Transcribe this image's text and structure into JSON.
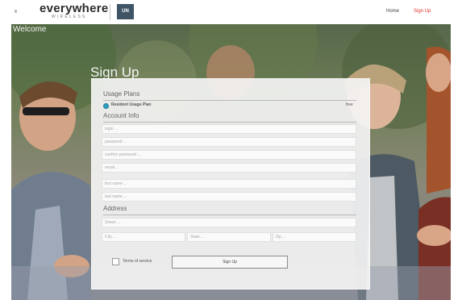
{
  "brand": {
    "name": "everywhere",
    "tagline": "WIRELESS",
    "badge": "UN"
  },
  "nav": {
    "home": "Home",
    "signup": "Sign Up"
  },
  "hero": {
    "welcome": "Welcome",
    "heading": "Sign Up"
  },
  "usage_plans": {
    "title": "Usage Plans",
    "plan_label": "Resident Usage Plan",
    "plan_price": "free",
    "plan_selected": true
  },
  "account": {
    "title": "Account Info",
    "login_placeholder": "login ...",
    "password_placeholder": "password ...",
    "confirm_placeholder": "confirm password ...",
    "email_placeholder": "email ...",
    "first_name_placeholder": "first name ...",
    "last_name_placeholder": "last name ..."
  },
  "address": {
    "title": "Address",
    "street_placeholder": "Street ...",
    "city_placeholder": "City ...",
    "state_placeholder": "State ...",
    "zip_placeholder": "Zip ..."
  },
  "terms": {
    "label": "Terms of service",
    "checked": false
  },
  "submit": {
    "label": "Sign Up"
  },
  "colors": {
    "accent": "#d8342f",
    "radio": "#2a9fbf",
    "badge": "#3f5566"
  }
}
